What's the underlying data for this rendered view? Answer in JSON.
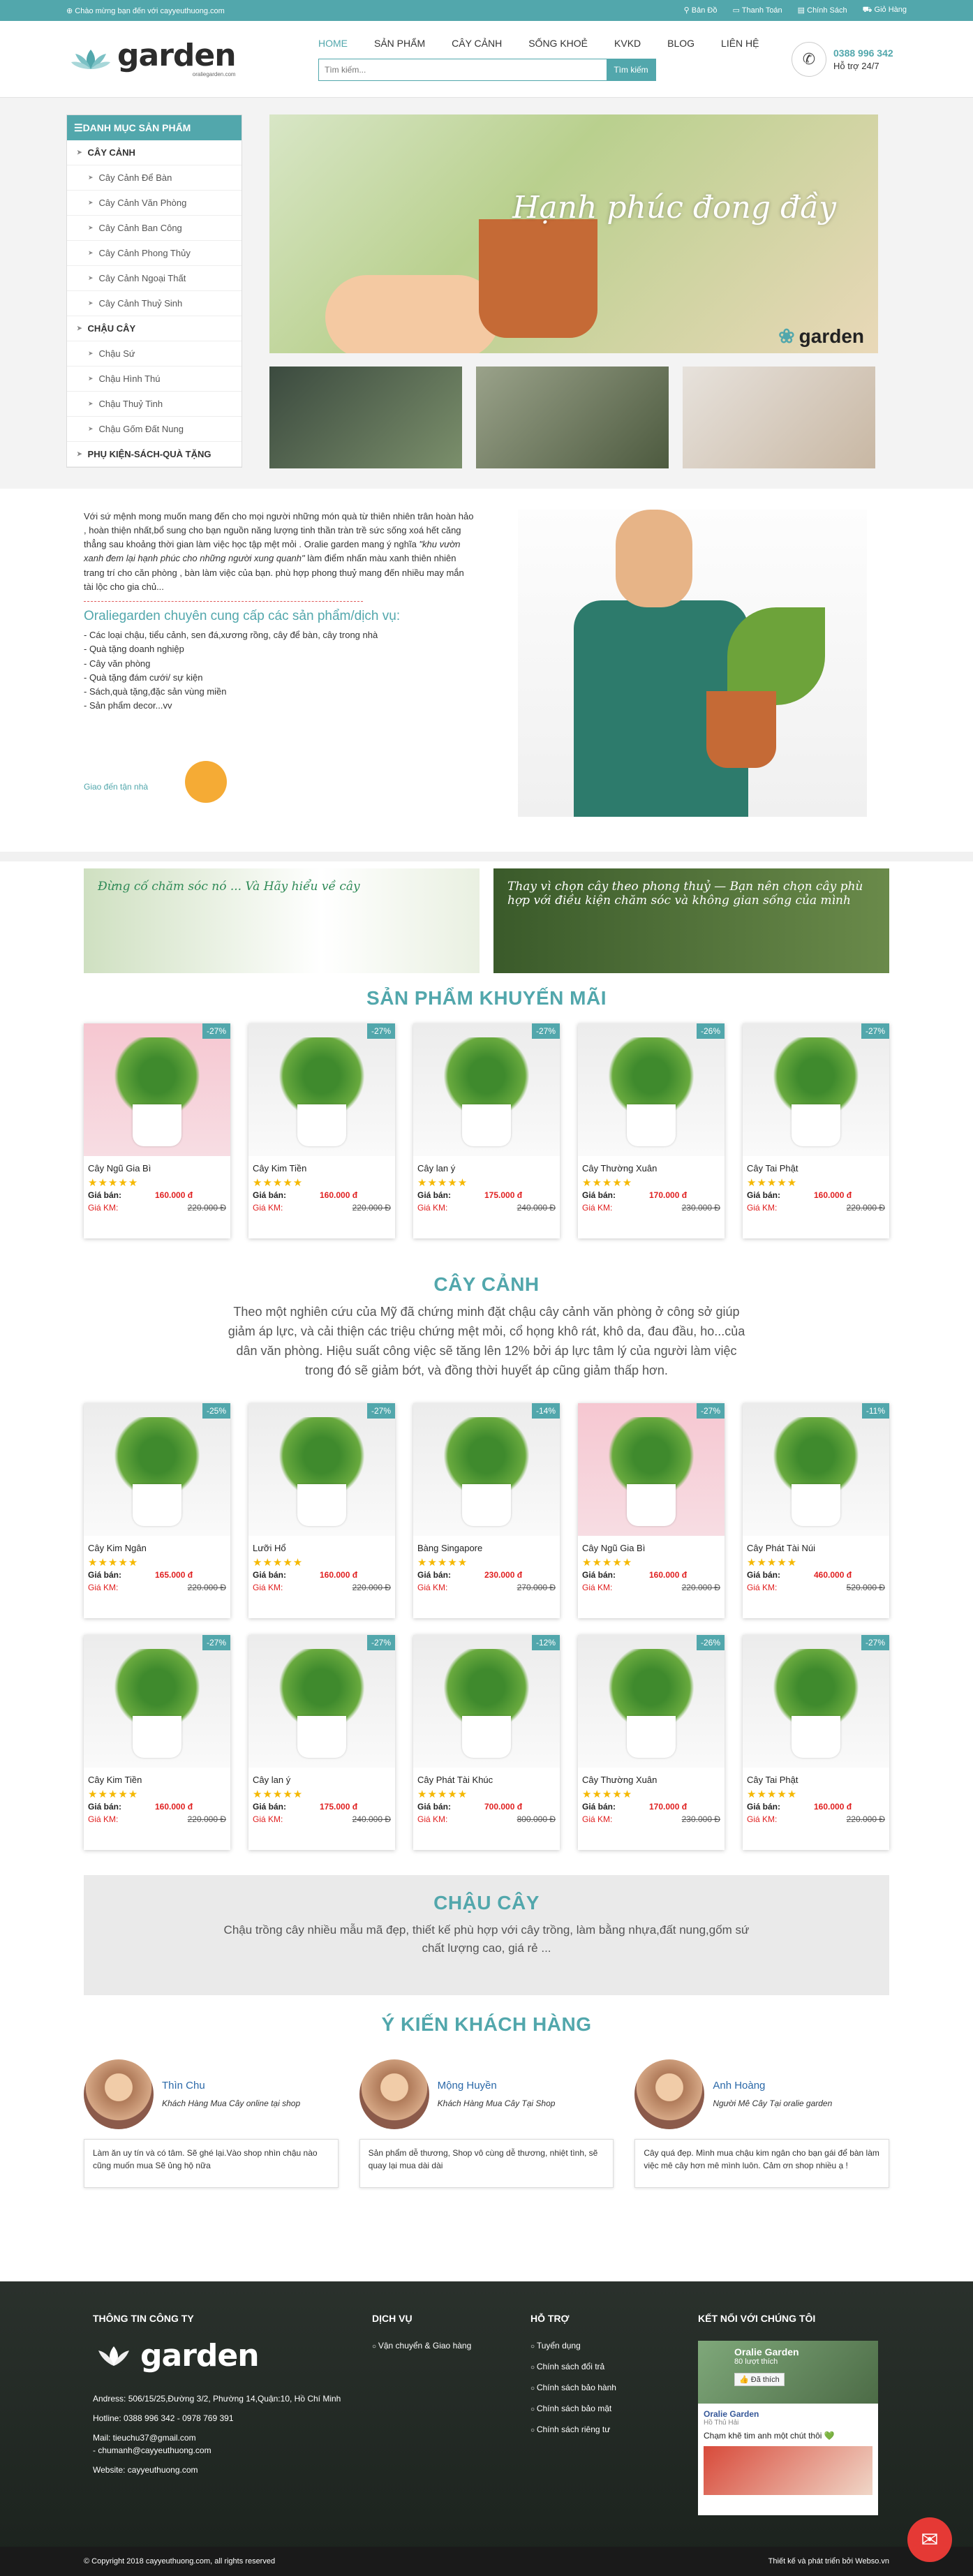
{
  "topbar": {
    "welcome": "Chào mừng bạn đến với cayyeuthuong.com",
    "links": [
      "Bản Đồ",
      "Thanh Toán",
      "Chính Sách",
      "Giỏ Hàng"
    ]
  },
  "header": {
    "logo_word": "garden",
    "logo_sub": "oraliegarden.com",
    "nav": [
      "HOME",
      "SẢN PHẨM",
      "CÂY CẢNH",
      "SỐNG KHOẺ",
      "KVKD",
      "BLOG",
      "LIÊN HỆ"
    ],
    "search_placeholder": "Tìm kiếm...",
    "search_button": "Tìm kiếm",
    "hotline": "0388 996 342",
    "support": "Hỗ trợ 24/7"
  },
  "sidebar": {
    "title": "DANH MỤC SẢN PHẨM",
    "items": [
      {
        "label": "CÂY CẢNH",
        "type": "cat"
      },
      {
        "label": "Cây Cảnh Để Bàn",
        "type": "sub"
      },
      {
        "label": "Cây Cảnh Văn Phòng",
        "type": "sub"
      },
      {
        "label": "Cây Cảnh Ban Công",
        "type": "sub"
      },
      {
        "label": "Cây Cảnh Phong Thủy",
        "type": "sub"
      },
      {
        "label": "Cây Cảnh Ngoại Thất",
        "type": "sub"
      },
      {
        "label": "Cây Cảnh Thuỷ Sinh",
        "type": "sub"
      },
      {
        "label": "CHẬU CÂY",
        "type": "cat"
      },
      {
        "label": "Chậu Sứ",
        "type": "sub"
      },
      {
        "label": "Chậu Hình Thú",
        "type": "sub"
      },
      {
        "label": "Chậu Thuỷ Tinh",
        "type": "sub"
      },
      {
        "label": "Chậu Gốm Đất Nung",
        "type": "sub"
      },
      {
        "label": "PHỤ KIỆN-SÁCH-QUÀ TẶNG",
        "type": "cat"
      }
    ]
  },
  "banner": {
    "script": "Hạnh phúc đong đầy",
    "brand": "garden"
  },
  "intro": {
    "p1": "Với sứ mệnh mong muốn mang đến cho mọi người những món quà từ thiên nhiên trân hoàn hảo , hoàn thiện nhất,bổ sung cho bạn nguồn năng lượng tinh thần tràn trề sức sống xoá hết căng thẳng sau khoảng thời gian làm việc học tập mệt mỏi . Oralie garden mang ý nghĩa ",
    "p1_italic": "\"khu vườn xanh đem lại hạnh phúc cho những người xung quanh\"",
    "p1_end": " làm điểm nhấn màu xanh thiên nhiên trang trí cho căn phòng , bàn làm việc của bạn. phù hợp phong thuỷ mang đến nhiều may mắn tài lộc cho gia chủ...",
    "heading": "Oraliegarden chuyên cung cấp các sản phẩm/dịch vụ:",
    "list": [
      "- Các loại chậu, tiểu cảnh, sen đá,xương rồng, cây để bàn, cây trong nhà",
      "- Quà tặng doanh nghiệp",
      "- Cây văn phòng",
      "- Quà tặng đám cưới/ sự kiện",
      "- Sách,quà tặng,đặc sản vùng miền",
      "- Sản phẩm decor...vv"
    ],
    "delivery": "Giao đến tận nhà"
  },
  "promo": {
    "left": "Đừng cố chăm sóc nó ... Và Hãy hiểu về cây",
    "right": "Thay vì chọn cây theo phong thuỷ — Bạn nên chọn cây phù hợp với điều kiện chăm sóc và không gian sống của mình"
  },
  "sections": {
    "promo_title": "SẢN PHẨM KHUYẾN MÃI",
    "plants_title": "CÂY CẢNH",
    "plants_desc": "Theo một nghiên cứu của Mỹ đã chứng minh đặt chậu cây cảnh văn phòng ở công sở giúp giảm áp lực, và cải thiện các triệu chứng mệt mỏi, cổ họng khô rát, khô da, đau đầu, ho...của dân văn phòng. Hiệu suất công việc sẽ tăng lên 12% bởi áp lực tâm lý của người làm việc trong đó sẽ giảm bớt, và đồng thời huyết áp cũng giảm thấp hơn.",
    "pots_title": "CHẬU CÂY",
    "pots_desc": "Chậu trồng cây nhiều mẫu mã đẹp, thiết kế phù hợp với cây trồng, làm bằng nhựa,đất nung,gốm sứ chất lượng cao, giá rẻ ...",
    "reviews_title": "Ý KIẾN KHÁCH HÀNG",
    "sell_label": "Giá bán:",
    "km_label": "Giá KM:"
  },
  "promo_products": [
    {
      "name": "Cây Ngũ Gia Bì",
      "disc": "-27%",
      "price": "160.000 đ",
      "old": "220.000 Đ",
      "pink": true
    },
    {
      "name": "Cây Kim Tiền",
      "disc": "-27%",
      "price": "160.000 đ",
      "old": "220.000 Đ",
      "pink": false
    },
    {
      "name": "Cây lan ý",
      "disc": "-27%",
      "price": "175.000 đ",
      "old": "240.000 Đ",
      "pink": false
    },
    {
      "name": "Cây Thường Xuân",
      "disc": "-26%",
      "price": "170.000 đ",
      "old": "230.000 Đ",
      "pink": false
    },
    {
      "name": "Cây Tai Phật",
      "disc": "-27%",
      "price": "160.000 đ",
      "old": "220.000 Đ",
      "pink": false
    }
  ],
  "plant_products": [
    {
      "name": "Cây Kim Ngân",
      "disc": "-25%",
      "price": "165.000 đ",
      "old": "220.000 Đ",
      "pink": false
    },
    {
      "name": "Lưỡi Hổ",
      "disc": "-27%",
      "price": "160.000 đ",
      "old": "220.000 Đ",
      "pink": false
    },
    {
      "name": "Bàng Singapore",
      "disc": "-14%",
      "price": "230.000 đ",
      "old": "270.000 Đ",
      "pink": false
    },
    {
      "name": "Cây Ngũ Gia Bì",
      "disc": "-27%",
      "price": "160.000 đ",
      "old": "220.000 Đ",
      "pink": true
    },
    {
      "name": "Cây Phát Tài Núi",
      "disc": "-11%",
      "price": "460.000 đ",
      "old": "520.000 Đ",
      "pink": false
    },
    {
      "name": "Cây Kim Tiền",
      "disc": "-27%",
      "price": "160.000 đ",
      "old": "220.000 Đ",
      "pink": false
    },
    {
      "name": "Cây lan ý",
      "disc": "-27%",
      "price": "175.000 đ",
      "old": "240.000 Đ",
      "pink": false
    },
    {
      "name": "Cây Phát Tài Khúc",
      "disc": "-12%",
      "price": "700.000 đ",
      "old": "800.000 Đ",
      "pink": false
    },
    {
      "name": "Cây Thường Xuân",
      "disc": "-26%",
      "price": "170.000 đ",
      "old": "230.000 Đ",
      "pink": false
    },
    {
      "name": "Cây Tai Phật",
      "disc": "-27%",
      "price": "160.000 đ",
      "old": "220.000 Đ",
      "pink": false
    }
  ],
  "reviews": [
    {
      "name": "Thìn Chu",
      "role": "Khách Hàng Mua Cây online tại shop",
      "quote": "Làm ăn uy tín và có tâm. Sẽ ghé lại.Vào shop nhìn chậu nào cũng muốn mua Sẽ ủng hộ nữa"
    },
    {
      "name": "Mộng Huyền",
      "role": "Khách Hàng Mua Cây Tại Shop",
      "quote": "Sản phẩm dễ thương, Shop vô cùng dễ thương, nhiệt tình, sẽ quay lại mua dài dài"
    },
    {
      "name": "Anh Hoàng",
      "role": "Người Mê Cây Tại oralie garden",
      "quote": "Cây quá đẹp. Mình mua chậu kim ngân cho bạn gái để bàn làm việc mê cây hơn mê mình luôn. Cảm ơn shop nhiều ạ !"
    }
  ],
  "footer": {
    "company_title": "THÔNG TIN CÔNG TY",
    "address": "Andress: 506/15/25,Đường 3/2, Phường 14,Quận:10, Hồ Chí Minh",
    "hotline": "Hotline: 0388 996 342 - 0978 769 391",
    "mail1": "Mail: tieuchu37@gmail.com",
    "mail2": "- chumanh@cayyeuthuong.com",
    "website": "Website: cayyeuthuong.com",
    "service_title": "DỊCH VỤ",
    "services": [
      "Vận chuyển & Giao hàng"
    ],
    "support_title": "HỖ TRỢ",
    "support": [
      "Tuyển dụng",
      "Chính sách đổi trả",
      "Chính sách bảo hành",
      "Chính sách bảo mật",
      "Chính sách riêng tư"
    ],
    "connect_title": "KẾT NỐI VỚI CHÚNG TÔI",
    "fb_name": "Oralie Garden",
    "fb_likes": "80 lượt thích",
    "fb_like_btn": "Đã thích",
    "fb_post_name": "Oralie Garden",
    "fb_post_loc": "Hồ Thủ Hải",
    "fb_post_text": "Chạm khẽ tim anh một chút thôi 💚",
    "copyright": "© Copyright 2018 cayyeuthuong.com, all rights reserved",
    "made_by": "Thiết kế và phát triển bởi Webso.vn"
  }
}
